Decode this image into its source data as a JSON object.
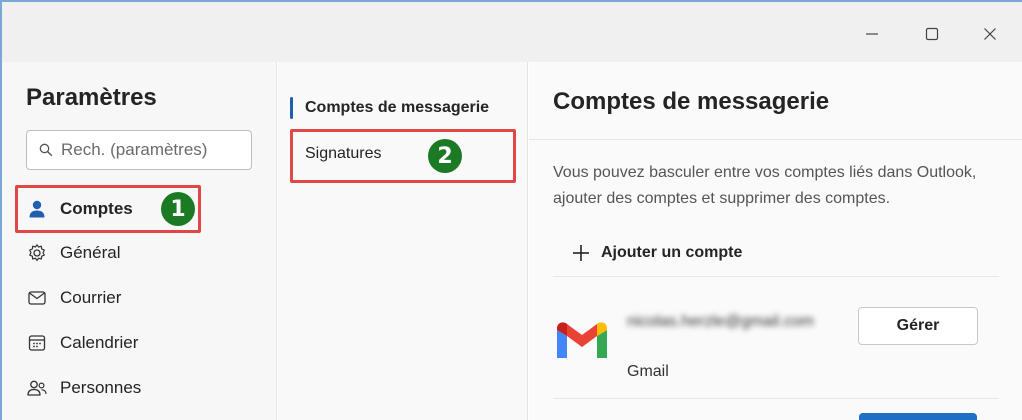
{
  "window": {
    "minimize_icon": "minimize-icon",
    "maximize_icon": "maximize-icon",
    "close_icon": "close-icon"
  },
  "settings": {
    "title": "Paramètres",
    "search_placeholder": "Rech. (paramètres)"
  },
  "nav": {
    "items": [
      {
        "label": "Comptes",
        "icon": "person-icon"
      },
      {
        "label": "Général",
        "icon": "gear-icon"
      },
      {
        "label": "Courrier",
        "icon": "mail-icon"
      },
      {
        "label": "Calendrier",
        "icon": "calendar-icon"
      },
      {
        "label": "Personnes",
        "icon": "people-icon"
      }
    ]
  },
  "subnav": {
    "items": [
      {
        "label": "Comptes de messagerie"
      },
      {
        "label": "Signatures"
      }
    ]
  },
  "annotations": {
    "badge1": "1",
    "badge2": "2",
    "color_box": "#e04848",
    "color_badge": "#1c7a24"
  },
  "content": {
    "title": "Comptes de messagerie",
    "description": "Vous pouvez basculer entre vos comptes liés dans Outlook, ajouter des comptes et supprimer des comptes.",
    "add_account_label": "Ajouter un compte",
    "account": {
      "email": "nicolas.herzle@gmail.com",
      "type": "Gmail",
      "manage_label": "Gérer"
    }
  }
}
